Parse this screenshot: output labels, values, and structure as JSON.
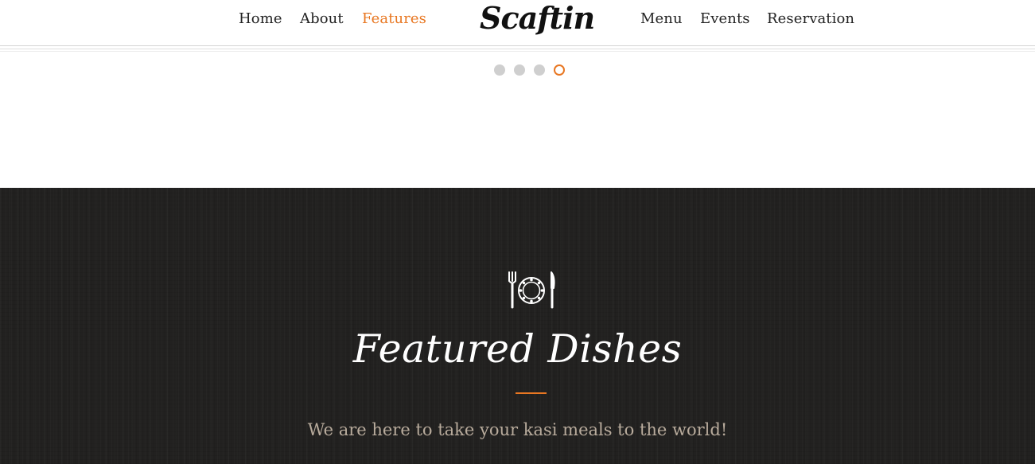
{
  "header": {
    "nav_left": [
      {
        "label": "Home"
      },
      {
        "label": "About"
      },
      {
        "label": "Features",
        "active": true
      }
    ],
    "logo": "Scaftin",
    "nav_right": [
      {
        "label": "Menu"
      },
      {
        "label": "Events"
      },
      {
        "label": "Reservation"
      }
    ]
  },
  "slider": {
    "dot_count": 4,
    "active_index": 3
  },
  "featured": {
    "icon": "plate-fork-knife-icon",
    "title": "Featured Dishes",
    "subtitle": "We are here to take your kasi meals to the world!"
  },
  "colors": {
    "accent": "#e87722",
    "dark_background": "#222120",
    "subtitle_text": "#b8ab9c"
  }
}
